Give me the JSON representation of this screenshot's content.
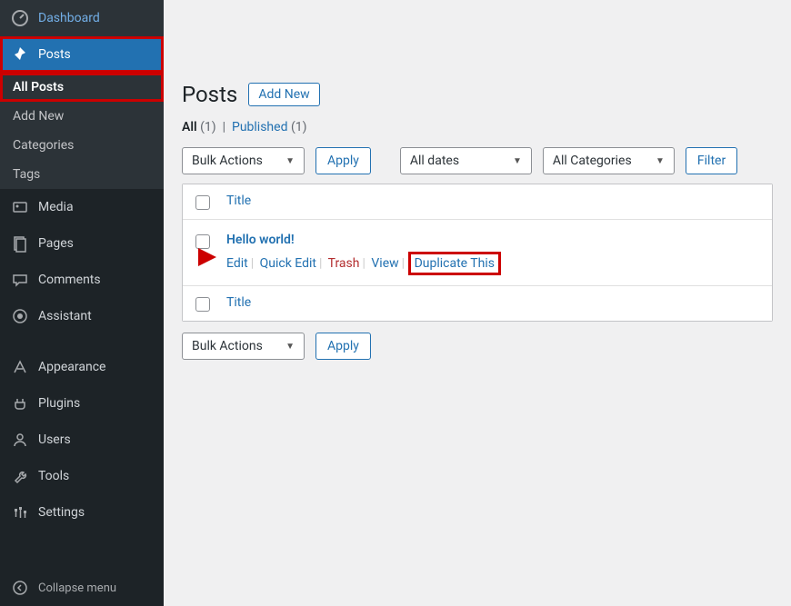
{
  "sidebar": {
    "dashboard": "Dashboard",
    "posts": "Posts",
    "submenu": {
      "all_posts": "All Posts",
      "add_new": "Add New",
      "categories": "Categories",
      "tags": "Tags"
    },
    "media": "Media",
    "pages": "Pages",
    "comments": "Comments",
    "assistant": "Assistant",
    "appearance": "Appearance",
    "plugins": "Plugins",
    "users": "Users",
    "tools": "Tools",
    "settings": "Settings",
    "collapse": "Collapse menu"
  },
  "main": {
    "title": "Posts",
    "add_new": "Add New",
    "filters": {
      "all_label": "All",
      "all_count": "(1)",
      "sep": "|",
      "published_label": "Published",
      "published_count": "(1)"
    },
    "bulk_actions": "Bulk Actions",
    "apply": "Apply",
    "all_dates": "All dates",
    "all_categories": "All Categories",
    "filter": "Filter",
    "col_title": "Title",
    "post": {
      "title": "Hello world!",
      "edit": "Edit",
      "quick_edit": "Quick Edit",
      "trash": "Trash",
      "view": "View",
      "duplicate": "Duplicate This"
    }
  }
}
